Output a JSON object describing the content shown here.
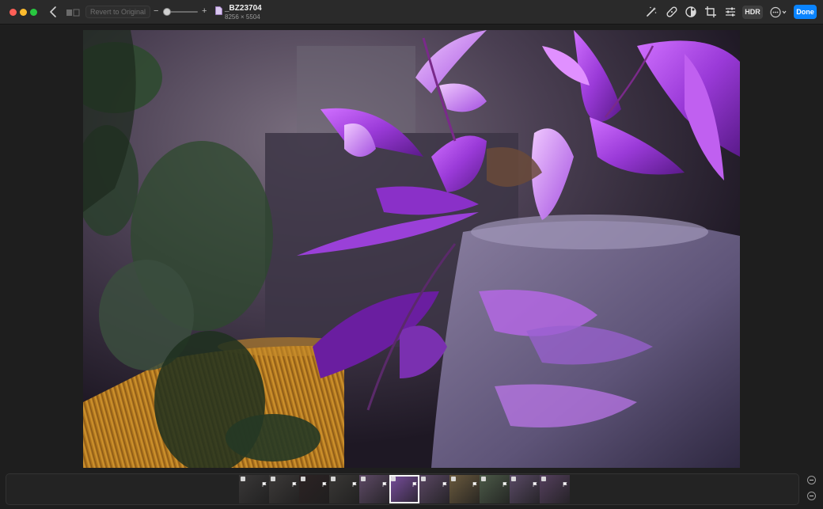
{
  "toolbar": {
    "revert_label": "Revert to Original",
    "zoom_level": 0.12,
    "file_name": "_BZ23704",
    "file_dimensions": "8256 × 5504",
    "hdr_label": "HDR",
    "done_label": "Done",
    "tools": [
      "magic-wand-icon",
      "retouch-bandage-icon",
      "filters-circle-icon",
      "crop-icon",
      "adjust-sliders-icon"
    ]
  },
  "colors": {
    "accent": "#0a84ff",
    "close": "#ff5f57",
    "minimize": "#febc2e",
    "maximize": "#28c840"
  },
  "filmstrip": {
    "selected_index": 5,
    "thumbnails": [
      {
        "tone": "#3a3838"
      },
      {
        "tone": "#3d3a39"
      },
      {
        "tone": "#2c2324"
      },
      {
        "tone": "#3a3836"
      },
      {
        "tone": "#5e4a66"
      },
      {
        "tone": "#7a4fa0"
      },
      {
        "tone": "#5a4763"
      },
      {
        "tone": "#6a5a3e"
      },
      {
        "tone": "#4c5a48"
      },
      {
        "tone": "#5a4a66"
      },
      {
        "tone": "#55405e"
      }
    ]
  }
}
